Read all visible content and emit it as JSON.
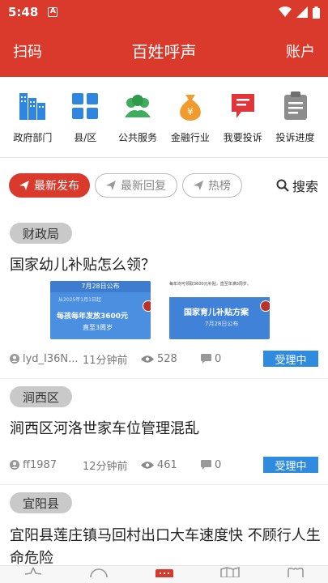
{
  "status_bar": {
    "time": "5:48",
    "badge": "A"
  },
  "app_bar": {
    "left": "扫码",
    "title": "百姓呼声",
    "right": "账户"
  },
  "shortcuts": [
    {
      "label": "政府部门",
      "icon": "building-icon"
    },
    {
      "label": "县/区",
      "icon": "grid-icon"
    },
    {
      "label": "公共服务",
      "icon": "people-icon"
    },
    {
      "label": "金融行业",
      "icon": "money-bag-icon"
    },
    {
      "label": "我要投诉",
      "icon": "complaint-icon"
    },
    {
      "label": "投诉进度",
      "icon": "clipboard-icon"
    }
  ],
  "tabs": [
    {
      "label": "最新发布",
      "active": true
    },
    {
      "label": "最新回复",
      "active": false
    },
    {
      "label": "热榜",
      "active": false
    }
  ],
  "search_label": "搜索",
  "posts": [
    {
      "section": "财政局",
      "title": "国家幼儿补贴怎么领？",
      "thumb1": {
        "top": "7月28日公布",
        "line1": "从2025年1月1日起",
        "line2": "每孩每年发放3600元",
        "line3": "直至3周岁"
      },
      "thumb2": {
        "top": "每年均可领取3600元补贴，直至年满3周岁。",
        "main": "国家育儿补贴方案",
        "sub": "7月28日公布"
      },
      "user": "lyd_I36N...",
      "time": "11分钟前",
      "views": "528",
      "comments": "0",
      "status": "受理中"
    },
    {
      "section": "涧西区",
      "title": "涧西区河洛世家车位管理混乱",
      "user": "ff1987",
      "time": "12分钟前",
      "views": "461",
      "comments": "0",
      "status": "受理中"
    },
    {
      "section": "宜阳县",
      "title": "宜阳县莲庄镇马回村出口大车速度快 不顾行人生命危险"
    }
  ],
  "colors": {
    "brand": "#d93a2b",
    "status": "#2e8be0"
  }
}
